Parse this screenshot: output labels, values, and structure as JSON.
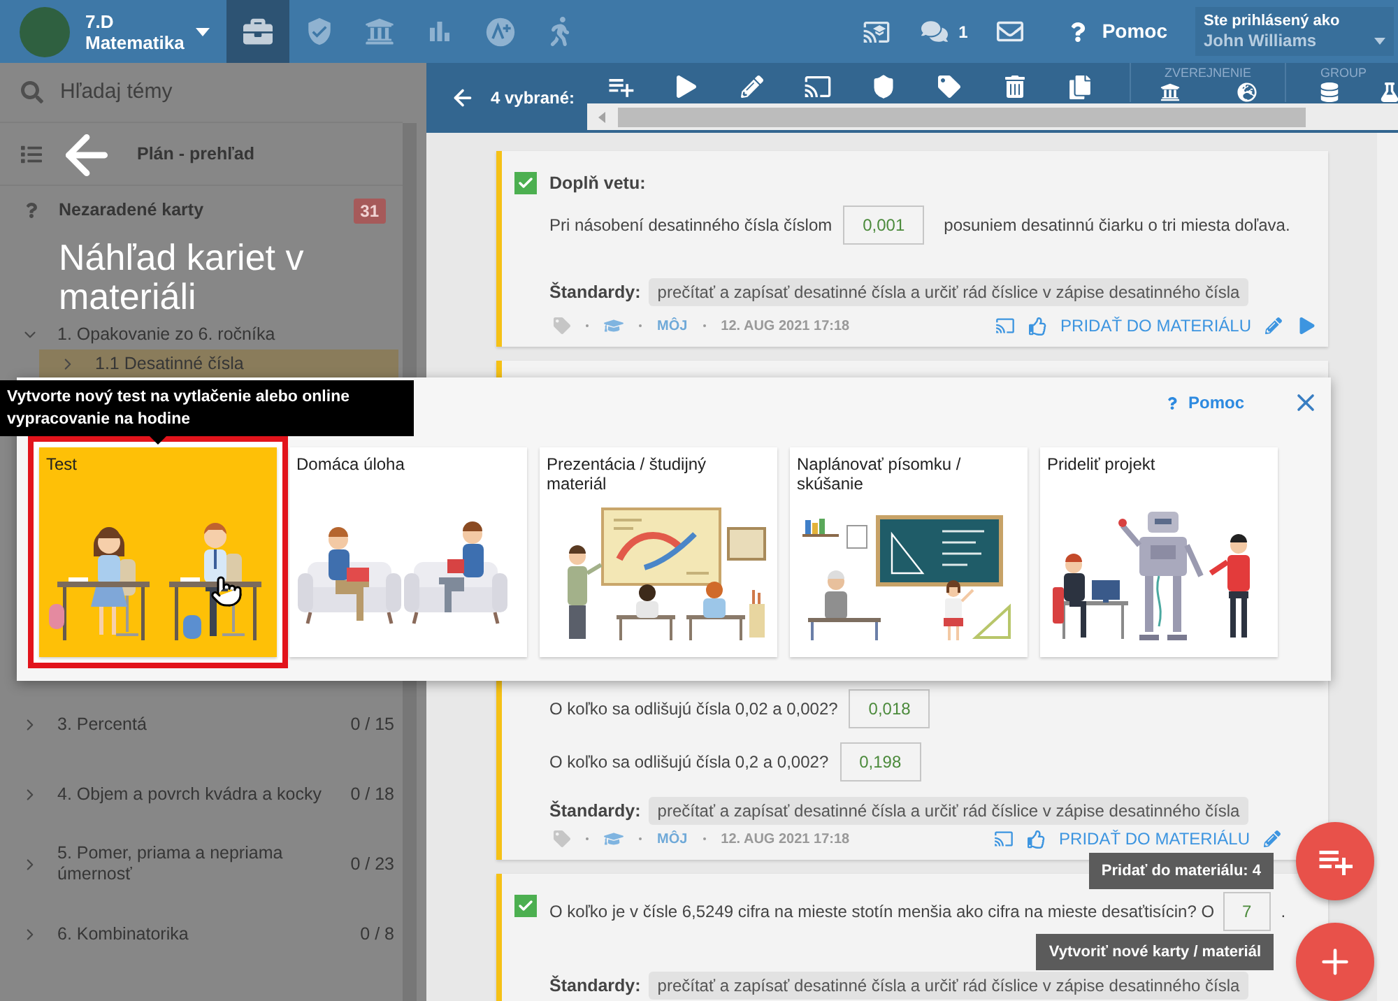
{
  "header": {
    "class_name": "7.D",
    "subject": "Matematika",
    "nav": [
      {
        "kind": "briefcase",
        "selected": true
      },
      {
        "kind": "shield",
        "selected": false
      },
      {
        "kind": "bank",
        "selected": false
      },
      {
        "kind": "chart",
        "selected": false
      },
      {
        "kind": "grade",
        "selected": false
      },
      {
        "kind": "walk",
        "selected": false
      }
    ],
    "messages_count": "1",
    "help": "Pomoc",
    "user": {
      "caption": "Ste prihlásený ako",
      "name": "John Williams"
    }
  },
  "sidebar": {
    "search": {
      "placeholder": "Hľadaj témy"
    },
    "items": [
      {
        "kind": "plan",
        "label": "Plán - prehľad",
        "selected": false
      },
      {
        "kind": "uncategorized",
        "label": "Nezaradené karty",
        "badge": "31",
        "selected": false
      },
      {
        "kind": "topic",
        "label": "1. Opakovanie zo 6. ročníka",
        "expanded": true,
        "selected": false,
        "children": [
          {
            "kind": "topic",
            "label": "1.1 Desatinné čísla",
            "expanded": false,
            "selected": true
          }
        ]
      },
      {
        "kind": "topic",
        "label": "3. Percentá",
        "count": "0 / 15",
        "expanded": false,
        "selected": false
      },
      {
        "kind": "topic",
        "label": "4. Objem a povrch kvádra a kocky",
        "count": "0 / 18",
        "expanded": false,
        "selected": false
      },
      {
        "kind": "topic",
        "label": "5. Pomer, priama a nepriama úmernosť",
        "count": "0 / 23",
        "expanded": false,
        "selected": false
      },
      {
        "kind": "topic",
        "label": "6. Kombinatorika",
        "count": "0 / 8",
        "expanded": false,
        "selected": false
      }
    ]
  },
  "preview_panel": {
    "title": "Náhľad kariet v materiáli"
  },
  "toolbar": {
    "selected_count": "4 vybrané:",
    "groups": [
      {
        "kind": "publish",
        "label": "ZVEREJNENIE"
      },
      {
        "kind": "group",
        "label": "GROUP"
      }
    ]
  },
  "cards": [
    {
      "kind": "fill_sentence",
      "checked": true,
      "title": "Doplň vetu:",
      "before": "Pri násobení desatinného čísla číslom",
      "answer": "0,001",
      "after": "posuniem desatinnú čiarku o tri miesta doľava.",
      "standards_label": "Štandardy:",
      "standard": "prečítať a zapísať desatinné čísla a určiť rád číslice v zápise desatinného čísla",
      "author": "MÔJ",
      "date": "12. AUG 2021 17:18",
      "action": "PRIDAŤ DO MATERIÁLU"
    },
    {
      "kind": "covered"
    },
    {
      "kind": "questions",
      "questions": [
        {
          "text": "O koľko sa odlišujú čísla 0,02 a 0,002?",
          "answer": "0,018"
        },
        {
          "text": "O koľko sa odlišujú čísla 0,2 a 0,002?",
          "answer": "0,198"
        }
      ],
      "standards_label": "Štandardy:",
      "standard": "prečítať a zapísať desatinné čísla a určiť rád číslice v zápise desatinného čísla",
      "author": "MÔJ",
      "date": "12. AUG 2021 17:18",
      "action": "PRIDAŤ DO MATERIÁLU"
    },
    {
      "kind": "question",
      "checked": true,
      "text": "O koľko je v čísle 6,5249 cifra na mieste stotín menšia ako cifra na mieste desaťtisícin? O",
      "answer": "7",
      "after": ".",
      "standards_label": "Štandardy:",
      "standard": "prečítať a zapísať desatinné čísla a určiť rád číslice v zápise desatinného čísla"
    }
  ],
  "create_dialog": {
    "help": "Pomoc",
    "tooltip": "Vytvorte nový test na vytlačenie alebo online vypracovanie na hodine",
    "options": [
      {
        "kind": "test",
        "label": "Test",
        "selected": true
      },
      {
        "kind": "homework",
        "label": "Domáca úloha",
        "selected": false
      },
      {
        "kind": "presentation",
        "label": "Prezentácia / študijný materiál",
        "selected": false
      },
      {
        "kind": "exam",
        "label": "Naplánovať písomku / skúšanie",
        "selected": false
      },
      {
        "kind": "project",
        "label": "Prideliť projekt",
        "selected": false
      }
    ]
  },
  "fabs": [
    {
      "kind": "add",
      "tooltip": "Pridať do materiálu: 4"
    },
    {
      "kind": "create",
      "tooltip": "Vytvoriť nové karty / materiál"
    }
  ]
}
